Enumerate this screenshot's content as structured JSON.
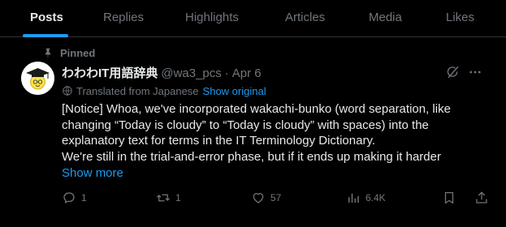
{
  "tabs": [
    {
      "label": "Posts",
      "active": true
    },
    {
      "label": "Replies",
      "active": false
    },
    {
      "label": "Highlights",
      "active": false
    },
    {
      "label": "Articles",
      "active": false
    },
    {
      "label": "Media",
      "active": false
    },
    {
      "label": "Likes",
      "active": false
    }
  ],
  "post": {
    "pinned_label": "Pinned",
    "display_name": "わわわIT用語辞典",
    "handle": "@wa3_pcs",
    "separator": "·",
    "date": "Apr 6",
    "translated_from": "Translated from Japanese",
    "show_original": "Show original",
    "text_lines": [
      "[Notice] Whoa, we've incorporated wakachi-bunko (word separation, like",
      "changing “Today is cloudy” to “Today is cloudy” with spaces) into the",
      "explanatory text for terms in the IT Terminology Dictionary.",
      "We're still in the trial-and-error phase, but if it ends up making it harder"
    ],
    "show_more": "Show more",
    "actions": {
      "replies": "1",
      "reposts": "1",
      "likes": "57",
      "views": "6.4K"
    }
  },
  "colors": {
    "background": "#000000",
    "text": "#e7e9ea",
    "muted": "#71767b",
    "accent": "#1d9bf0",
    "divider": "#2f3336"
  },
  "icons": [
    "pin-icon",
    "grok-icon",
    "more-icon",
    "translate-icon",
    "reply-icon",
    "repost-icon",
    "like-icon",
    "views-icon",
    "bookmark-icon",
    "share-icon"
  ]
}
